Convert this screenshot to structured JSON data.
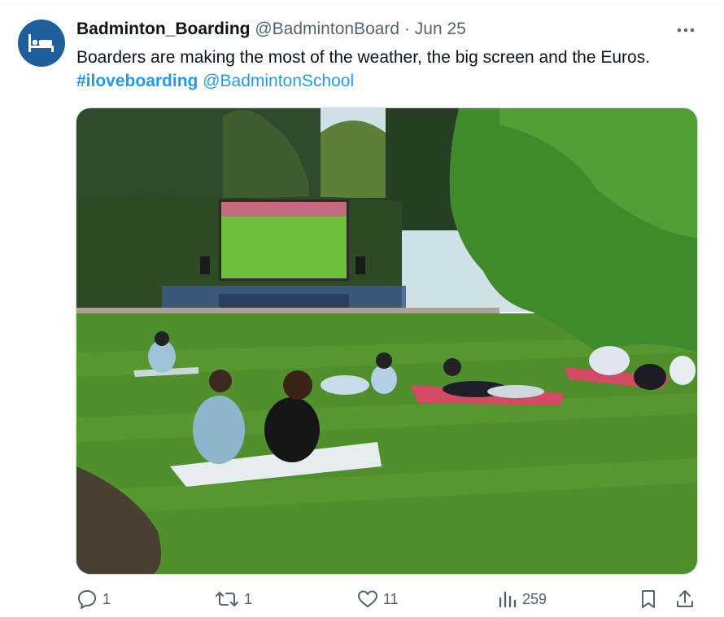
{
  "tweet": {
    "display_name": "Badminton_Boarding",
    "handle": "@BadmintonBoard",
    "separator": "·",
    "date": "Jun 25",
    "text": "Boarders are making the most of the weather, the big screen and the Euros.",
    "hashtag": "#iloveboarding",
    "mention": "@BadmintonSchool"
  },
  "avatar": {
    "icon": "bed-icon",
    "bg_color": "#1f5f9c"
  },
  "media": {
    "description_icon": "photo-of-outdoor-screening"
  },
  "actions": {
    "replies": "1",
    "reposts": "1",
    "likes": "11",
    "views": "259"
  },
  "colors": {
    "link": "#1d9bf0",
    "muted": "#536471",
    "text": "#0f1419"
  }
}
